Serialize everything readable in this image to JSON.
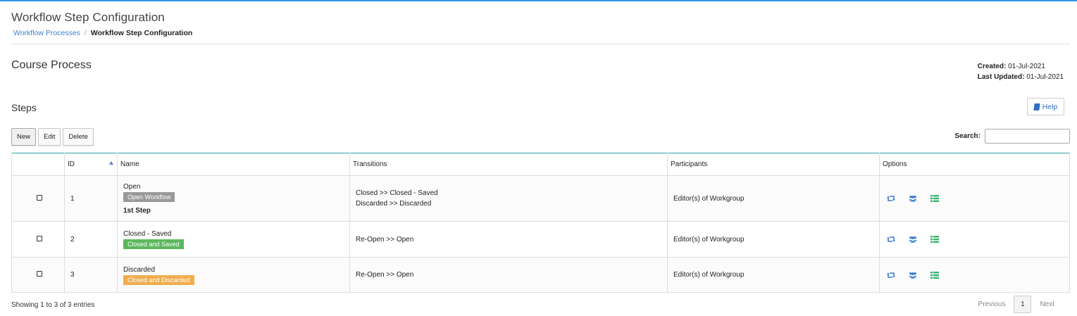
{
  "page": {
    "title": "Workflow Step Configuration"
  },
  "breadcrumb": {
    "parent": "Workflow Processes",
    "separator": "/",
    "current": "Workflow Step Configuration"
  },
  "process": {
    "name": "Course Process",
    "created_label": "Created:",
    "created_value": "01-Jul-2021",
    "updated_label": "Last Updated:",
    "updated_value": "01-Jul-2021"
  },
  "steps": {
    "heading": "Steps",
    "help_label": "Help"
  },
  "toolbar": {
    "new_label": "New",
    "edit_label": "Edit",
    "delete_label": "Delete"
  },
  "search": {
    "label": "Search:",
    "value": ""
  },
  "table": {
    "columns": [
      "",
      "ID",
      "Name",
      "Transitions",
      "Participants",
      "Options"
    ],
    "rows": [
      {
        "id": "1",
        "name": "Open",
        "badge": "Open Workflow",
        "badge_color": "#999999",
        "note": "1st Step",
        "transitions": [
          "Closed >> Closed - Saved",
          "Discarded >> Discarded"
        ],
        "participants": "Editor(s) of Workgroup"
      },
      {
        "id": "2",
        "name": "Closed - Saved",
        "badge": "Closed and Saved",
        "badge_color": "#5cb85c",
        "note": "",
        "transitions": [
          "Re-Open >> Open"
        ],
        "participants": "Editor(s) of Workgroup"
      },
      {
        "id": "3",
        "name": "Discarded",
        "badge": "Closed and Discarded",
        "badge_color": "#f0ad4e",
        "note": "",
        "transitions": [
          "Re-Open >> Open"
        ],
        "participants": "Editor(s) of Workgroup"
      }
    ]
  },
  "icons": {
    "transitions": "retweet-icon",
    "participants": "users-icon",
    "fields": "list-icon"
  },
  "colors": {
    "accent_blue": "#3a7fd0",
    "top_bar": "#2e9be6",
    "table_top_border": "#2aa5a8",
    "list_icon": "#3cb371"
  },
  "footer": {
    "info": "Showing 1 to 3 of 3 entries",
    "previous": "Previous",
    "current_page": "1",
    "next": "Next"
  }
}
